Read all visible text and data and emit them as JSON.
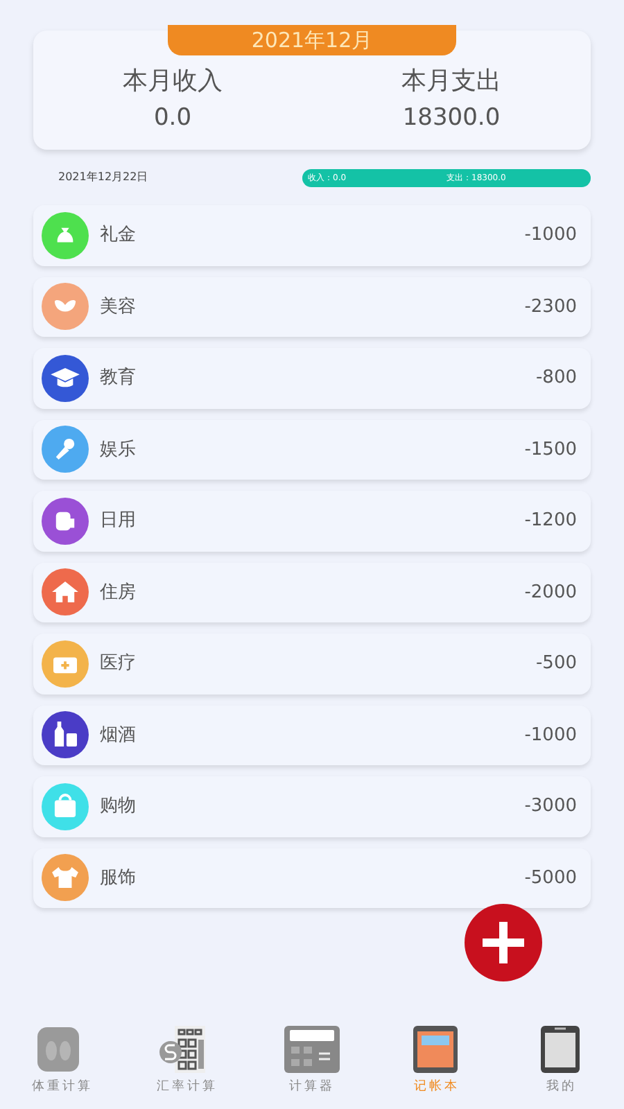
{
  "header": {
    "month": "2021年12月",
    "income_label": "本月收入",
    "income": "0.0",
    "expense_label": "本月支出",
    "expense": "18300.0"
  },
  "summary": {
    "date": "2021年12月22日",
    "income": "收入：0.0",
    "expense": "支出：18300.0"
  },
  "entries": [
    {
      "category": "礼金",
      "amount": "-1000",
      "color": "#4ee04e"
    },
    {
      "category": "美容",
      "amount": "-2300",
      "color": "#f4a57c"
    },
    {
      "category": "教育",
      "amount": "-800",
      "color": "#3458d6"
    },
    {
      "category": "娱乐",
      "amount": "-1500",
      "color": "#4eaaf0"
    },
    {
      "category": "日用",
      "amount": "-1200",
      "color": "#9a50d6"
    },
    {
      "category": "住房",
      "amount": "-2000",
      "color": "#ee6a4c"
    },
    {
      "category": "医疗",
      "amount": "-500",
      "color": "#f3b34a"
    },
    {
      "category": "烟酒",
      "amount": "-1000",
      "color": "#4a3cc6"
    },
    {
      "category": "购物",
      "amount": "-3000",
      "color": "#3fe0e8"
    },
    {
      "category": "服饰",
      "amount": "-5000",
      "color": "#f2a050"
    }
  ],
  "tabs": [
    {
      "label": "体重计算",
      "selected": false
    },
    {
      "label": "汇率计算",
      "selected": false
    },
    {
      "label": "计算器",
      "selected": false
    },
    {
      "label": "记帐本",
      "selected": true
    },
    {
      "label": "我的",
      "selected": false
    }
  ]
}
